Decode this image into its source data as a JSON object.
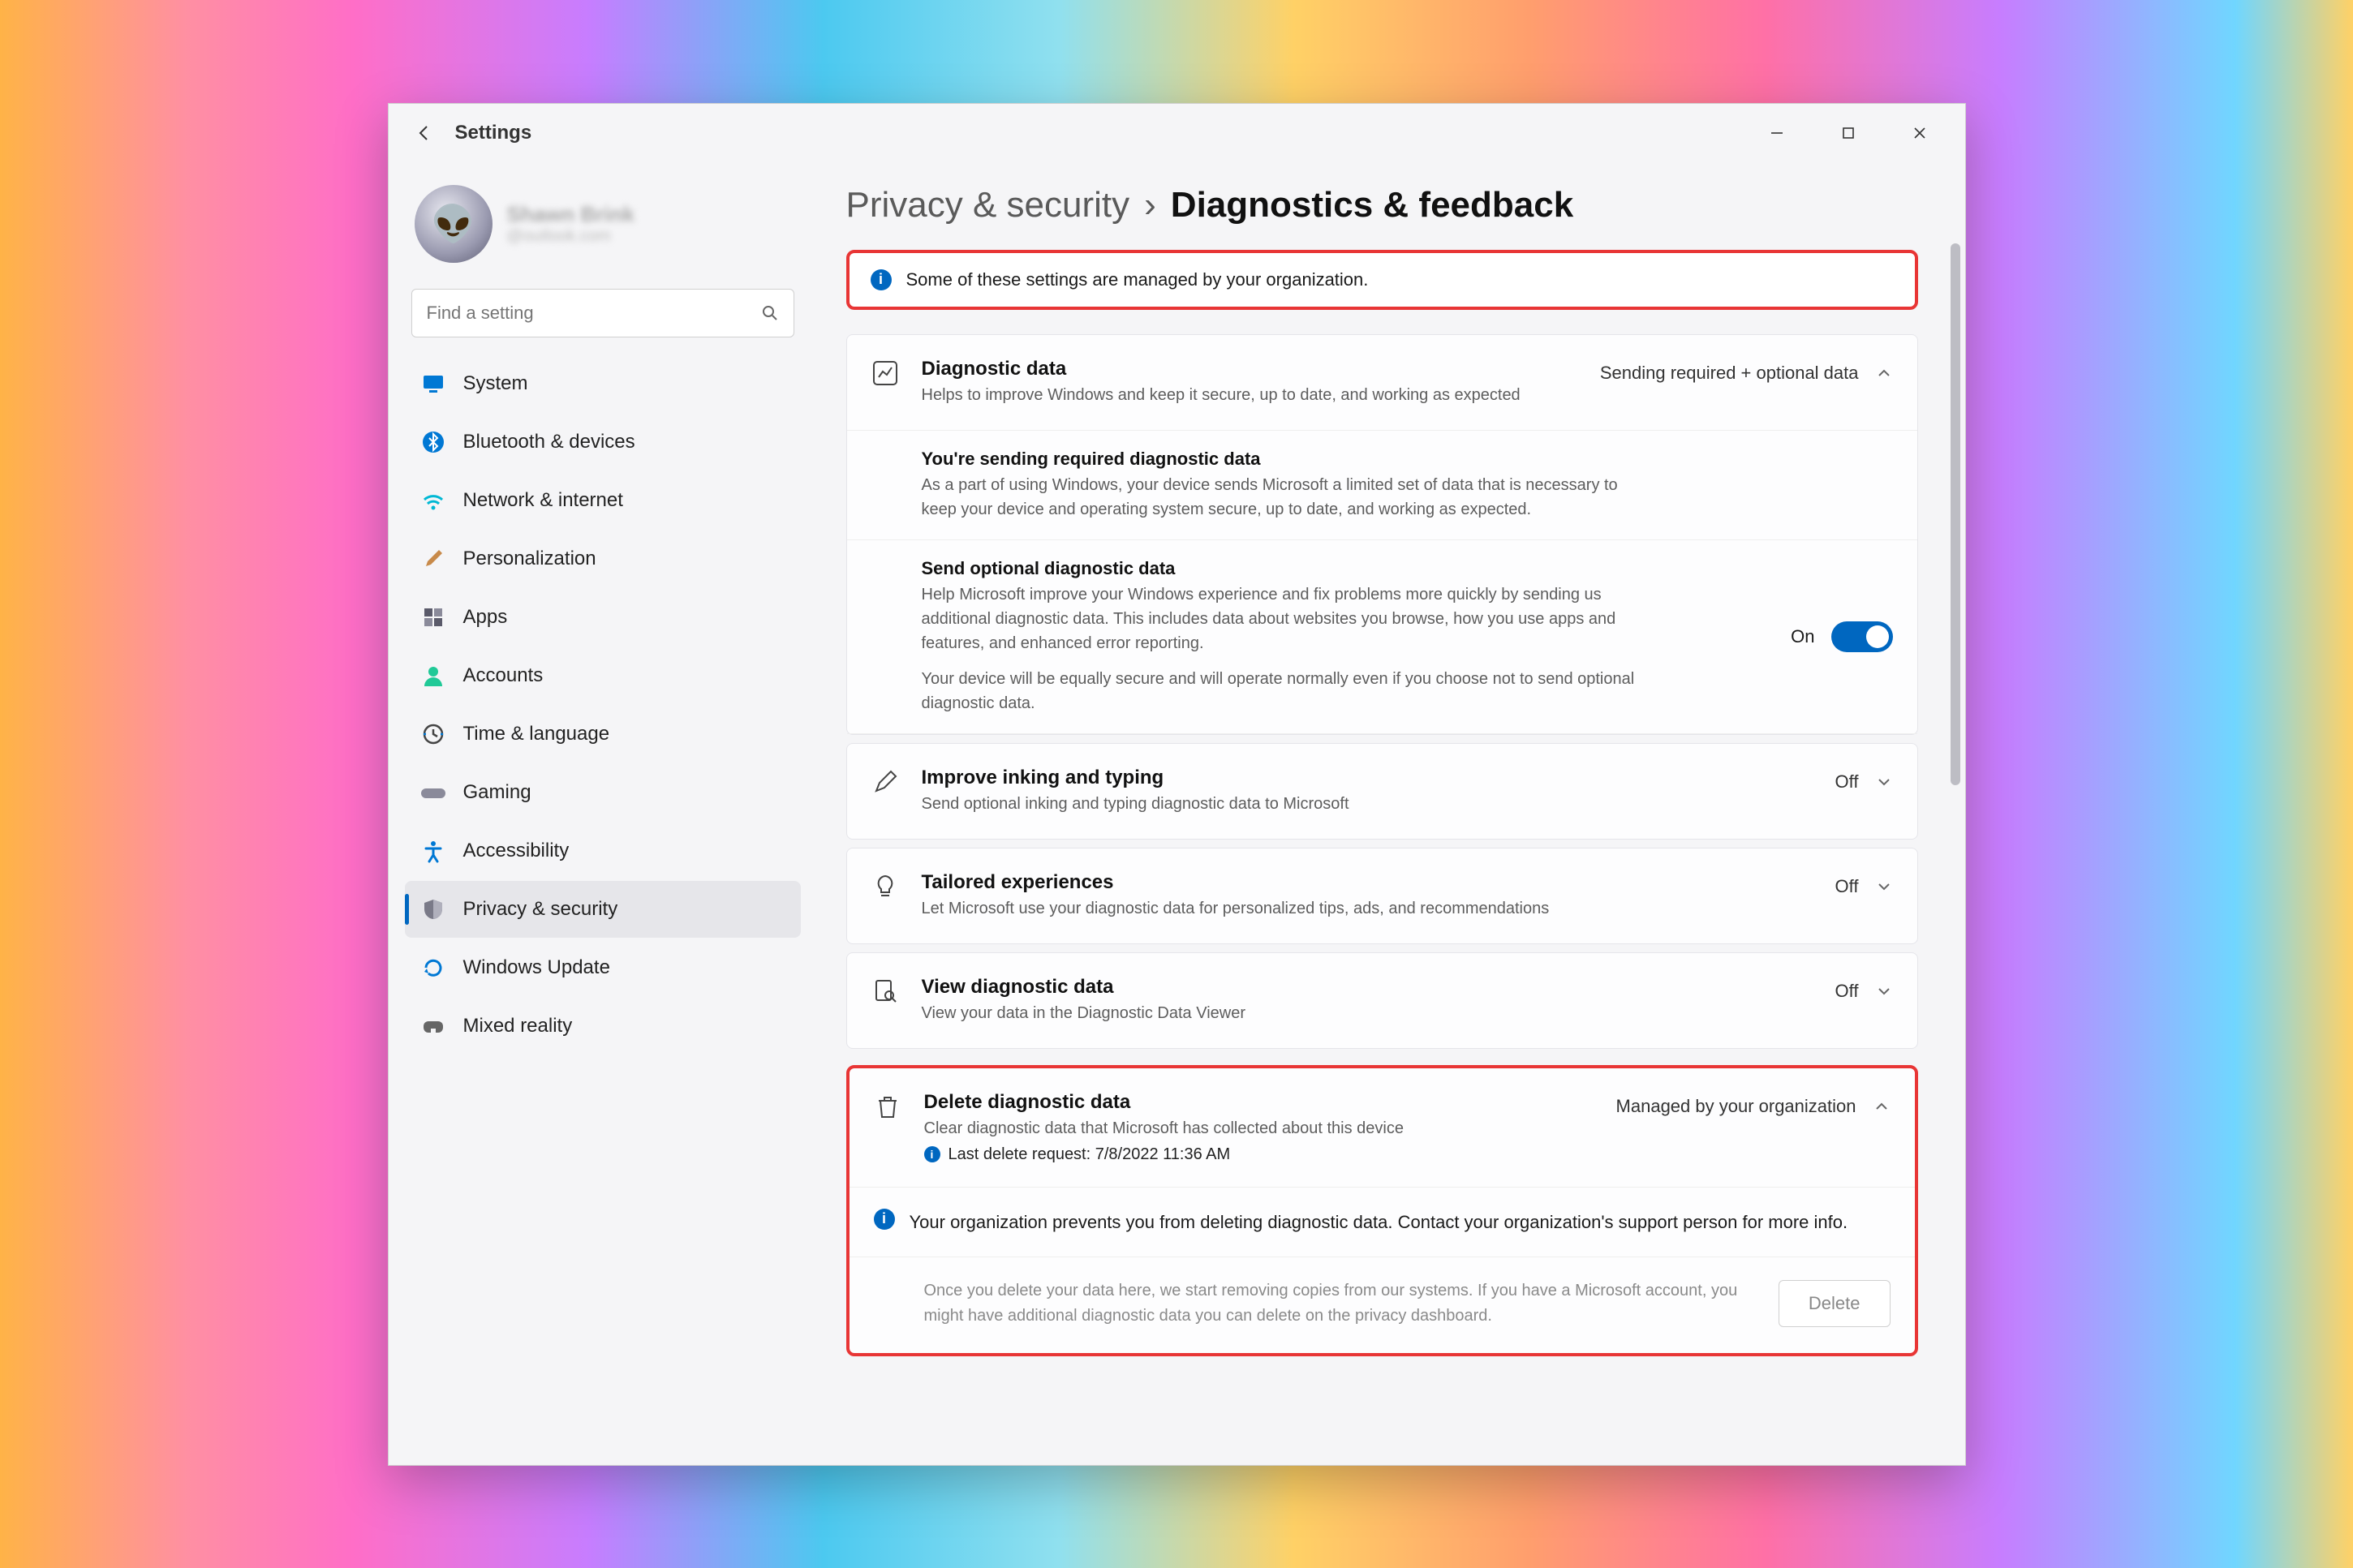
{
  "app_title": "Settings",
  "profile": {
    "name": "Shawn Brink",
    "email": "@outlook.com"
  },
  "search": {
    "placeholder": "Find a setting"
  },
  "nav": [
    {
      "id": "system",
      "label": "System"
    },
    {
      "id": "bluetooth",
      "label": "Bluetooth & devices"
    },
    {
      "id": "network",
      "label": "Network & internet"
    },
    {
      "id": "personalization",
      "label": "Personalization"
    },
    {
      "id": "apps",
      "label": "Apps"
    },
    {
      "id": "accounts",
      "label": "Accounts"
    },
    {
      "id": "time",
      "label": "Time & language"
    },
    {
      "id": "gaming",
      "label": "Gaming"
    },
    {
      "id": "accessibility",
      "label": "Accessibility"
    },
    {
      "id": "privacy",
      "label": "Privacy & security"
    },
    {
      "id": "update",
      "label": "Windows Update"
    },
    {
      "id": "mixed",
      "label": "Mixed reality"
    }
  ],
  "breadcrumb": {
    "parent": "Privacy & security",
    "current": "Diagnostics & feedback"
  },
  "banner": "Some of these settings are managed by your organization.",
  "diagnostic_data": {
    "title": "Diagnostic data",
    "desc": "Helps to improve Windows and keep it secure, up to date, and working as expected",
    "status": "Sending required + optional data",
    "required_title": "You're sending required diagnostic data",
    "required_desc": "As a part of using Windows, your device sends Microsoft a limited set of data that is necessary to keep your device and operating system secure, up to date, and working as expected.",
    "optional_title": "Send optional diagnostic data",
    "optional_desc": "Help Microsoft improve your Windows experience and fix problems more quickly by sending us additional diagnostic data. This includes data about websites you browse, how you use apps and features, and enhanced error reporting.",
    "optional_desc2": "Your device will be equally secure and will operate normally even if you choose not to send optional diagnostic data.",
    "optional_state": "On"
  },
  "inking": {
    "title": "Improve inking and typing",
    "desc": "Send optional inking and typing diagnostic data to Microsoft",
    "state": "Off"
  },
  "tailored": {
    "title": "Tailored experiences",
    "desc": "Let Microsoft use your diagnostic data for personalized tips, ads, and recommendations",
    "state": "Off"
  },
  "view": {
    "title": "View diagnostic data",
    "desc": "View your data in the Diagnostic Data Viewer",
    "state": "Off"
  },
  "delete": {
    "title": "Delete diagnostic data",
    "desc": "Clear diagnostic data that Microsoft has collected about this device",
    "last_request": "Last delete request: 7/8/2022 11:36 AM",
    "status": "Managed by your organization",
    "org_msg": "Your organization prevents you from deleting diagnostic data. Contact your organization's support person for more info.",
    "info": "Once you delete your data here, we start removing copies from our systems. If you have a Microsoft account, you might have additional diagnostic data you can delete on the privacy dashboard.",
    "button": "Delete"
  }
}
